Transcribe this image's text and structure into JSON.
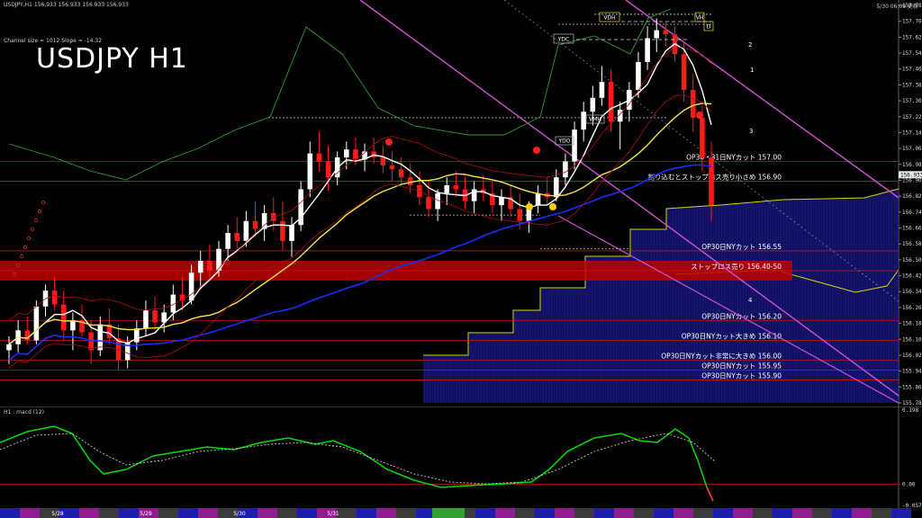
{
  "header": {
    "symbol_info": "USDJPY,H1  156.933 156.933 156.933 156.933",
    "clock": "5/30 06:09 更新",
    "channel_info": "Channel size = 1012  Slope = -14.32",
    "big_title": "USDJPY H1",
    "macd_label": "H1 : macd (12)"
  },
  "price_axis": [
    "157.785",
    "157.705",
    "157.625",
    "157.545",
    "157.465",
    "157.385",
    "157.305",
    "157.225",
    "157.145",
    "157.065",
    "156.985",
    "156.905",
    "156.825",
    "156.745",
    "156.665",
    "156.585",
    "156.505",
    "156.425",
    "156.345",
    "156.265",
    "156.185",
    "156.105",
    "156.025",
    "155.945",
    "155.865",
    "155.785"
  ],
  "current_price": "156.933",
  "macd_axis": [
    "0.198",
    "0.00",
    "-0.057"
  ],
  "levels": [
    {
      "price": 157.0,
      "label": "OP30・31日NYカット 157.00"
    },
    {
      "price": 156.9,
      "label": "割り込むとストップロス売り小さめ 156.90"
    },
    {
      "price": 156.55,
      "label": "OP30日NYカット 156.55"
    },
    {
      "price": 156.45,
      "label": "ストップロス売り 156.40-50"
    },
    {
      "price": 156.2,
      "label": "OP30日NYカット 156.20"
    },
    {
      "price": 156.1,
      "label": "OP30日NYカット大きめ 156.10"
    },
    {
      "price": 156.0,
      "label": "OP30日NYカット非常に大きめ 156.00"
    },
    {
      "price": 155.95,
      "label": "OP30日NYカット 155.95"
    },
    {
      "price": 155.9,
      "label": "OP30日NYカット 155.90"
    }
  ],
  "boxes": [
    "VDH",
    "VH",
    "D",
    "YDC",
    "VMH",
    "YDO"
  ],
  "channel_numbers": [
    "1",
    "2",
    "3",
    "4"
  ],
  "dates": [
    "5/28",
    "5/29",
    "5/30",
    "5/31"
  ],
  "colors": {
    "bull": "#ffffff",
    "bear": "#ff1a1a",
    "ma_white": "#ffffff",
    "ma_yellow": "#f2e64a",
    "ma_blue": "#1a2cff",
    "bb": "#b01010",
    "ichimoku_green": "#2f9d2f",
    "channel": "#d050d0",
    "stop_band": "#c00000",
    "macd_line": "#00dd00",
    "macd_signal": "#cccccc"
  },
  "chart_data": {
    "type": "candlestick",
    "title": "USDJPY H1",
    "ylim": [
      155.785,
      157.785
    ],
    "candles": [
      [
        156.05,
        156.12,
        155.98,
        156.08
      ],
      [
        156.08,
        156.2,
        156.04,
        156.15
      ],
      [
        156.15,
        156.22,
        156.08,
        156.1
      ],
      [
        156.1,
        156.3,
        156.08,
        156.27
      ],
      [
        156.27,
        156.38,
        156.22,
        156.35
      ],
      [
        156.35,
        156.42,
        156.25,
        156.28
      ],
      [
        156.28,
        156.35,
        156.1,
        156.15
      ],
      [
        156.15,
        156.24,
        156.05,
        156.2
      ],
      [
        156.2,
        156.28,
        156.12,
        156.14
      ],
      [
        156.14,
        156.2,
        155.98,
        156.05
      ],
      [
        156.05,
        156.22,
        156.02,
        156.18
      ],
      [
        156.18,
        156.26,
        156.08,
        156.11
      ],
      [
        156.11,
        156.18,
        155.95,
        156.0
      ],
      [
        156.0,
        156.12,
        155.96,
        156.09
      ],
      [
        156.09,
        156.2,
        156.05,
        156.16
      ],
      [
        156.16,
        156.3,
        156.12,
        156.25
      ],
      [
        156.25,
        156.32,
        156.15,
        156.19
      ],
      [
        156.19,
        156.28,
        156.14,
        156.24
      ],
      [
        156.24,
        156.38,
        156.2,
        156.33
      ],
      [
        156.33,
        156.42,
        156.25,
        156.3
      ],
      [
        156.3,
        156.48,
        156.28,
        156.44
      ],
      [
        156.44,
        156.55,
        156.36,
        156.5
      ],
      [
        156.5,
        156.58,
        156.4,
        156.45
      ],
      [
        156.45,
        156.6,
        156.42,
        156.56
      ],
      [
        156.56,
        156.68,
        156.5,
        156.64
      ],
      [
        156.64,
        156.72,
        156.55,
        156.6
      ],
      [
        156.6,
        156.75,
        156.57,
        156.7
      ],
      [
        156.7,
        156.8,
        156.62,
        156.66
      ],
      [
        156.66,
        156.78,
        156.6,
        156.74
      ],
      [
        156.74,
        156.82,
        156.65,
        156.7
      ],
      [
        156.7,
        156.8,
        156.55,
        156.6
      ],
      [
        156.6,
        156.72,
        156.52,
        156.68
      ],
      [
        156.68,
        156.9,
        156.65,
        156.86
      ],
      [
        156.86,
        157.1,
        156.82,
        157.04
      ],
      [
        157.04,
        157.15,
        156.95,
        157.0
      ],
      [
        157.0,
        157.08,
        156.85,
        156.92
      ],
      [
        156.92,
        157.05,
        156.88,
        157.02
      ],
      [
        157.02,
        157.1,
        156.96,
        157.06
      ],
      [
        157.06,
        157.12,
        156.98,
        157.01
      ],
      [
        157.01,
        157.09,
        156.95,
        157.05
      ],
      [
        157.05,
        157.12,
        156.99,
        157.02
      ],
      [
        157.02,
        157.08,
        156.94,
        156.98
      ],
      [
        156.98,
        157.05,
        156.9,
        156.96
      ],
      [
        156.96,
        157.02,
        156.88,
        156.92
      ],
      [
        156.92,
        156.99,
        156.84,
        156.88
      ],
      [
        156.88,
        156.95,
        156.78,
        156.82
      ],
      [
        156.82,
        156.9,
        156.72,
        156.76
      ],
      [
        156.76,
        156.86,
        156.7,
        156.84
      ],
      [
        156.84,
        156.92,
        156.78,
        156.88
      ],
      [
        156.88,
        156.95,
        156.82,
        156.86
      ],
      [
        156.86,
        156.92,
        156.76,
        156.8
      ],
      [
        156.8,
        156.9,
        156.74,
        156.86
      ],
      [
        156.86,
        156.93,
        156.8,
        156.84
      ],
      [
        156.84,
        156.9,
        156.74,
        156.78
      ],
      [
        156.78,
        156.86,
        156.7,
        156.82
      ],
      [
        156.82,
        156.88,
        156.72,
        156.76
      ],
      [
        156.76,
        156.84,
        156.66,
        156.7
      ],
      [
        156.7,
        156.8,
        156.64,
        156.78
      ],
      [
        156.78,
        156.88,
        156.74,
        156.84
      ],
      [
        156.84,
        156.92,
        156.78,
        156.82
      ],
      [
        156.82,
        156.96,
        156.8,
        156.92
      ],
      [
        156.92,
        157.04,
        156.88,
        157.0
      ],
      [
        157.0,
        157.2,
        156.96,
        157.16
      ],
      [
        157.16,
        157.3,
        157.1,
        157.25
      ],
      [
        157.25,
        157.38,
        157.18,
        157.32
      ],
      [
        157.32,
        157.48,
        157.28,
        157.4
      ],
      [
        157.4,
        157.46,
        157.15,
        157.2
      ],
      [
        157.2,
        157.3,
        157.06,
        157.26
      ],
      [
        157.26,
        157.4,
        157.2,
        157.36
      ],
      [
        157.36,
        157.55,
        157.32,
        157.5
      ],
      [
        157.5,
        157.68,
        157.46,
        157.62
      ],
      [
        157.62,
        157.72,
        157.55,
        157.66
      ],
      [
        157.66,
        157.7,
        157.58,
        157.64
      ],
      [
        157.64,
        157.68,
        157.5,
        157.54
      ],
      [
        157.54,
        157.6,
        157.3,
        157.36
      ],
      [
        157.36,
        157.44,
        157.15,
        157.22
      ],
      [
        157.22,
        157.28,
        156.95,
        157.02
      ],
      [
        157.02,
        157.1,
        156.7,
        156.78
      ]
    ]
  }
}
